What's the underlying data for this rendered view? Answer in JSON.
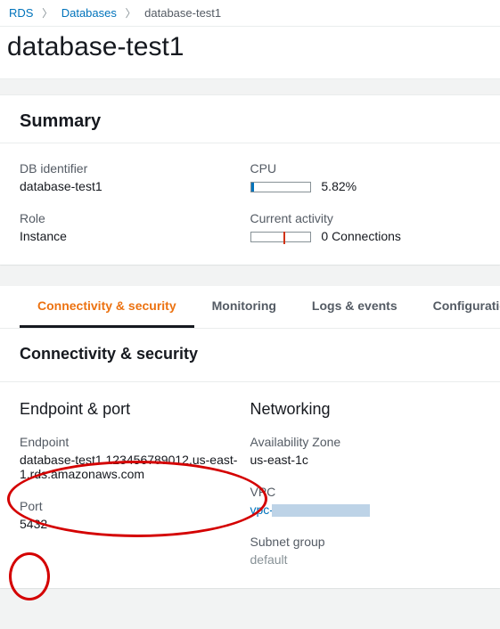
{
  "breadcrumb": {
    "root": "RDS",
    "databases": "Databases",
    "current": "database-test1"
  },
  "page_title": "database-test1",
  "summary": {
    "heading": "Summary",
    "db_identifier_label": "DB identifier",
    "db_identifier_value": "database-test1",
    "role_label": "Role",
    "role_value": "Instance",
    "cpu_label": "CPU",
    "cpu_value": "5.82%",
    "activity_label": "Current activity",
    "activity_value": "0 Connections"
  },
  "tabs": {
    "connectivity": "Connectivity & security",
    "monitoring": "Monitoring",
    "logs": "Logs & events",
    "configuration": "Configuration"
  },
  "conn": {
    "heading": "Connectivity & security",
    "endpoint_port_heading": "Endpoint & port",
    "endpoint_label": "Endpoint",
    "endpoint_value": "database-test1.123456789012.us-east-1.rds.amazonaws.com",
    "port_label": "Port",
    "port_value": "5432",
    "networking_heading": "Networking",
    "az_label": "Availability Zone",
    "az_value": "us-east-1c",
    "vpc_label": "VPC",
    "vpc_value": "vpc-",
    "subnet_label": "Subnet group",
    "subnet_value": "default"
  }
}
